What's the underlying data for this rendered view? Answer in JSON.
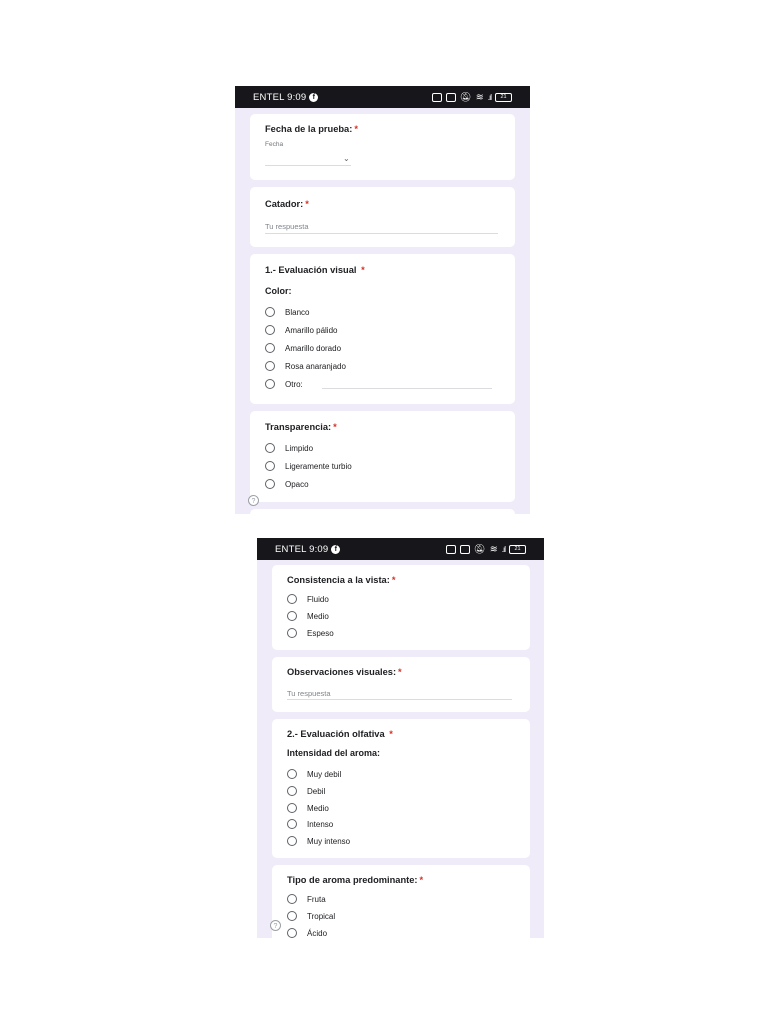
{
  "status_bar": {
    "carrier_time": "ENTEL 9:09",
    "facebook_icon": "facebook-icon",
    "battery": "21"
  },
  "page1": {
    "fecha": {
      "title": "Fecha de la prueba:",
      "required": "*",
      "date_label": "Fecha"
    },
    "catador": {
      "title": "Catador:",
      "required": "*",
      "placeholder": "Tu respuesta"
    },
    "visual": {
      "title": "1.- Evaluación visual",
      "required": "*",
      "subtitle": "Color:",
      "options": [
        "Blanco",
        "Amarillo pálido",
        "Amarillo dorado",
        "Rosa anaranjado",
        "Otro:"
      ]
    },
    "transparencia": {
      "title": "Transparencia:",
      "required": "*",
      "options": [
        "Limpido",
        "Ligeramente turbio",
        "Opaco"
      ]
    },
    "help": "?"
  },
  "page2": {
    "consistencia": {
      "title": "Consistencia a la vista:",
      "required": "*",
      "options": [
        "Fluido",
        "Medio",
        "Espeso"
      ]
    },
    "observaciones": {
      "title": "Observaciones visuales:",
      "required": "*",
      "placeholder": "Tu respuesta"
    },
    "olfativa": {
      "title": "2.- Evaluación olfativa",
      "required": "*",
      "subtitle": "Intensidad del aroma:",
      "options": [
        "Muy debil",
        "Debil",
        "Medio",
        "Intenso",
        "Muy intenso"
      ]
    },
    "tipo": {
      "title": "Tipo de aroma predominante:",
      "required": "*",
      "options": [
        "Fruta",
        "Tropical",
        "Ácido"
      ]
    },
    "help": "?"
  }
}
